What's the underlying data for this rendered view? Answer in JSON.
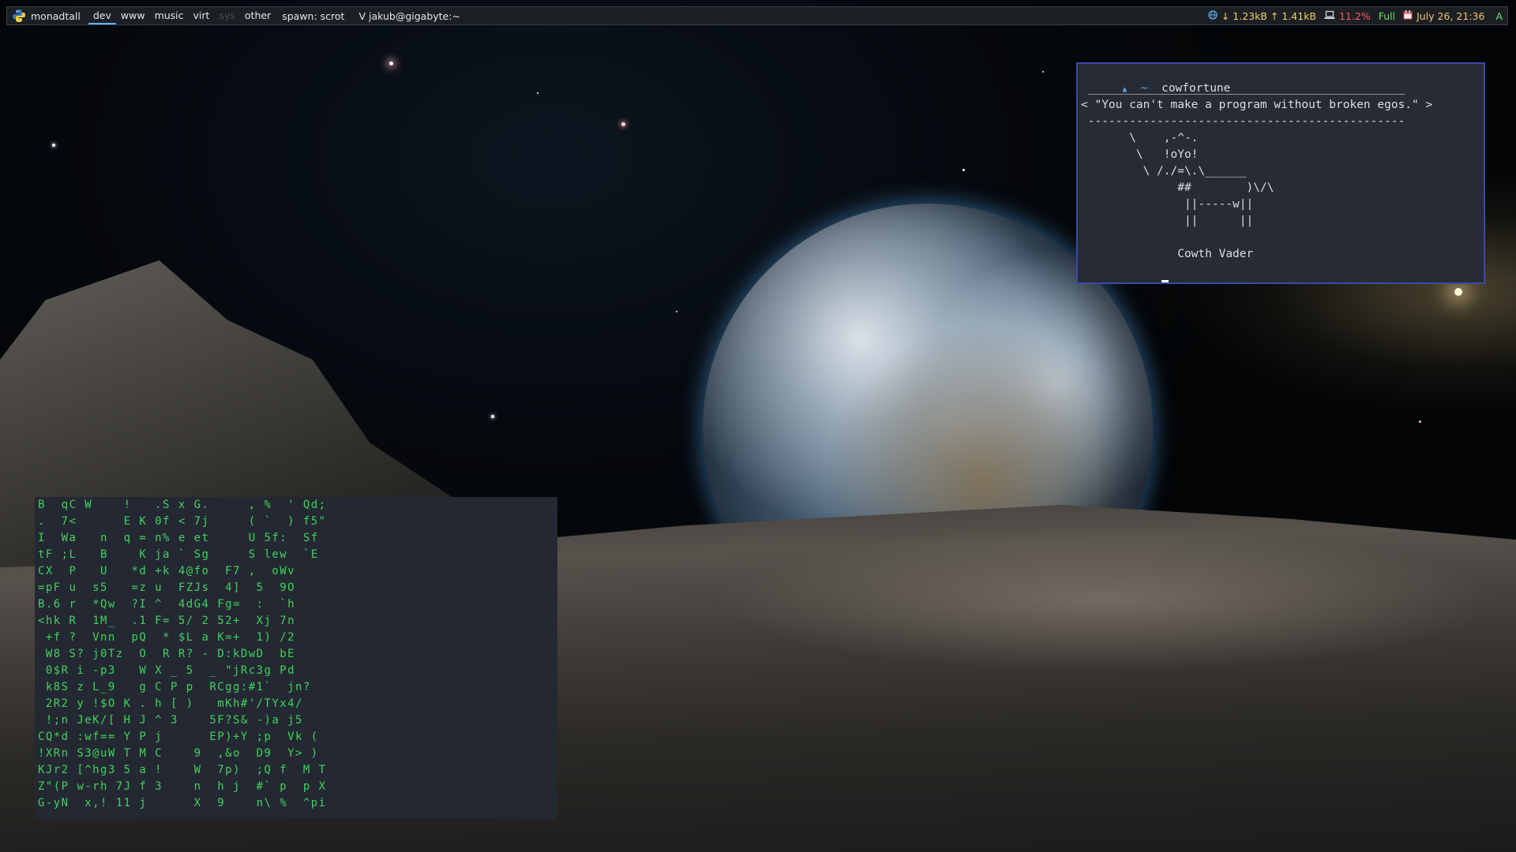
{
  "topbar": {
    "layout": "monadtall",
    "groups": [
      {
        "label": "dev",
        "state": "active"
      },
      {
        "label": "www",
        "state": "normal"
      },
      {
        "label": "music",
        "state": "normal"
      },
      {
        "label": "virt",
        "state": "normal"
      },
      {
        "label": "sys",
        "state": "empty"
      },
      {
        "label": "other",
        "state": "normal"
      }
    ],
    "prompt": "spawn: scrot",
    "window_title": "V jakub@gigabyte:~",
    "net": "↓ 1.23kB ↑ 1.41kB",
    "cpu": "11.2%",
    "battery": "Full",
    "clock": "July 26, 21:36",
    "keyboard": "A",
    "icons": {
      "logo": "python-logo-icon",
      "net": "globe-icon",
      "cpu": "laptop-icon",
      "clock": "calendar-icon"
    },
    "colors": {
      "active_underline": "#5fb3ff",
      "net": "#f0d36a",
      "cpu": "#ff5a5a",
      "battery": "#6ee06e",
      "clock": "#f3c36e"
    }
  },
  "cow_terminal": {
    "command": "cowfortune",
    "lines": [
      " ______________________________________________",
      "< \"You can't make a program without broken egos.\" >",
      " ----------------------------------------------",
      "       \\    ,-^-.",
      "        \\   !oYo!",
      "         \\ /./=\\.\\______",
      "              ##        )\\/\\",
      "               ||-----w||",
      "               ||      ||",
      "",
      "              Cowth Vader"
    ],
    "prompt_symbol": "~",
    "border_color": "#3a4aa8"
  },
  "matrix_terminal": {
    "text_color": "#3fd35a",
    "rows": [
      "B  qC W    !   .S x G.     , %  ' Qd;",
      ".  7<      E K 0f < 7j     ( `  ) f5\"",
      "I  Wa   n  q = n% e et     U 5f:  Sf",
      "tF ;L   B    K ja ` Sg     S lew  `E",
      "CX  P   U   *d +k 4@fo  F7 ,  oWv",
      "=pF u  s5   =z u  FZJs  4]  5  9O",
      "B.6 r  *Qw  ?I ^  4dG4 Fg=  :  `h",
      "<hk R  1M_  .1 F= 5/ 2 52+  Xj 7n",
      " +f ?  Vnn  pQ  * $L a K=+  1) /2",
      " W8 S? j0Tz  O  R R? - D:kDwD  bE",
      " 0$R i -p3   W X _ 5  _ \"jRc3g Pd",
      " k8S z L_9   g C P p  RCgg:#1`  jn?",
      " 2R2 y !$O K . h [ )   mKh#'/TYx4/",
      " !;n JeK/[ H J ^ 3    5F?S& -)a j5",
      "CQ*d :wf== Y P j      EP)+Y ;p  Vk (",
      "!XRn S3@uW T M C    9  ,&o  D9  Y> )",
      "KJr2 [^hg3 5 a !    W  7p)  ;Q f  M T",
      "Z\"(P w-rh 7J f 3    n  h j  #` p  p X",
      "G-yN  x,! 11 j      X  9    n\\ %  ^pi"
    ]
  }
}
